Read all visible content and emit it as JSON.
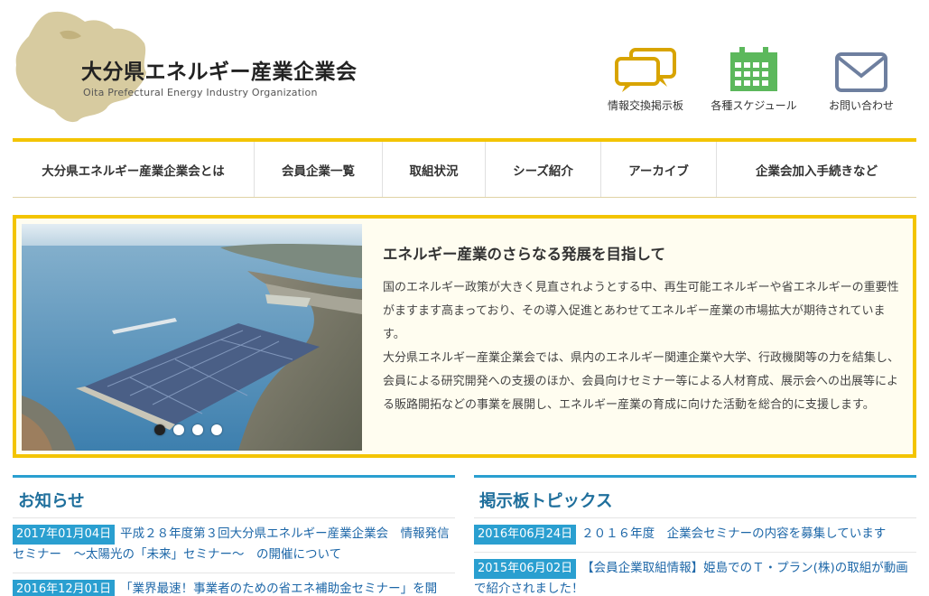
{
  "header": {
    "title": "大分県エネルギー産業企業会",
    "subtitle": "Oita Prefectural Energy Industry Organization",
    "utility_links": [
      {
        "label": "情報交換掲示板",
        "icon": "chat-bubbles-icon"
      },
      {
        "label": "各種スケジュール",
        "icon": "calendar-icon"
      },
      {
        "label": "お問い合わせ",
        "icon": "mail-icon"
      }
    ]
  },
  "nav": {
    "items": [
      {
        "label": "大分県エネルギー産業企業会とは"
      },
      {
        "label": "会員企業一覧"
      },
      {
        "label": "取組状況"
      },
      {
        "label": "シーズ紹介"
      },
      {
        "label": "アーカイブ"
      },
      {
        "label": "企業会加入手続きなど"
      }
    ]
  },
  "hero": {
    "heading": "エネルギー産業のさらなる発展を目指して",
    "paragraph1": "国のエネルギー政策が大きく見直されようとする中、再生可能エネルギーや省エネルギーの重要性がますます高まっており、その導入促進とあわせてエネルギー産業の市場拡大が期待されています。",
    "paragraph2": "大分県エネルギー産業企業会では、県内のエネルギー関連企業や大学、行政機関等の力を結集し、会員による研究開発への支援のほか、会員向けセミナー等による人材育成、展示会への出展等による販路開拓などの事業を展開し、エネルギー産業の育成に向けた活動を総合的に支援します。",
    "slide_count": 4,
    "active_slide": 1
  },
  "news": {
    "title": "お知らせ",
    "items": [
      {
        "date": "2017年01月04日",
        "text": "平成２８年度第３回大分県エネルギー産業企業会　情報発信セミナー　～太陽光の「未来」セミナー～　の開催について"
      },
      {
        "date": "2016年12月01日",
        "text": "「業界最速！事業者のための省エネ補助金セミナー」を開"
      }
    ]
  },
  "board": {
    "title": "掲示板トピックス",
    "items": [
      {
        "date": "2016年06月24日",
        "text": "２０１６年度　企業会セミナーの内容を募集しています"
      },
      {
        "date": "2015年06月02日",
        "text": "【会員企業取組情報】姫島でのＴ・プラン(株)の取組が動画で紹介されました！"
      }
    ]
  },
  "colors": {
    "accent_yellow": "#f3c400",
    "accent_blue": "#2a9fd0",
    "link_blue": "#1d67a8",
    "icon_gold": "#d8a400",
    "icon_green": "#5cb85c",
    "icon_slate": "#6e7f9f"
  }
}
